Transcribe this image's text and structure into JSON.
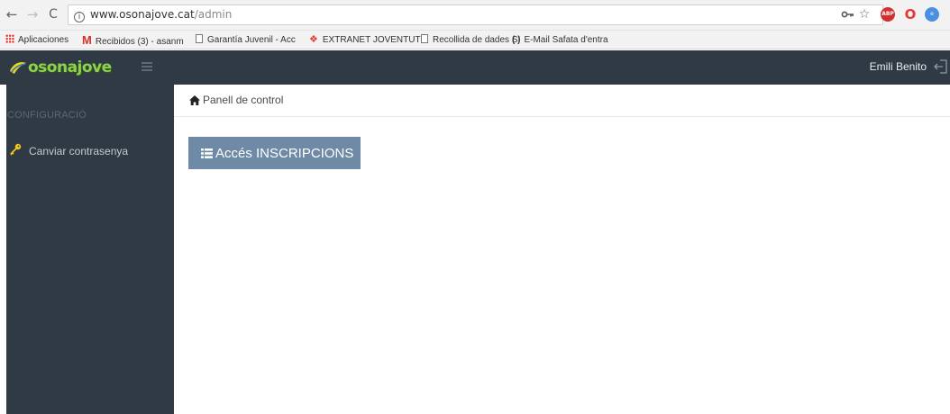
{
  "browser": {
    "url_host": "www.osonajove.cat",
    "url_path": "/admin",
    "bookmarks": [
      {
        "label": "Aplicaciones",
        "icon": "apps-grid-icon"
      },
      {
        "label": "Recibidos (3) - asanm",
        "icon": "gmail-icon"
      },
      {
        "label": "Garantía Juvenil - Acc",
        "icon": "page-icon"
      },
      {
        "label": "EXTRANET JOVENTUT",
        "icon": "extension-icon"
      },
      {
        "label": "Recollida de dades SI",
        "icon": "page-icon"
      },
      {
        "label": "E-Mail Safata d'entra",
        "icon": "parentheses-icon"
      }
    ],
    "gmail_glyph": "M",
    "paren_glyph": "( )"
  },
  "app": {
    "logo_text": "osonajove",
    "user_name": "Emili Benito",
    "colors": {
      "topbar": "#2f3a44",
      "logo_green": "#8fd14f",
      "button": "#6f8aa6",
      "key_yellow": "#f5c518"
    }
  },
  "sidebar": {
    "section_title": "CONFIGURACIÓ",
    "items": [
      {
        "label": "Canviar contrasenya",
        "icon": "key-icon"
      }
    ]
  },
  "breadcrumb": {
    "label": "Panell de control",
    "icon": "home-icon"
  },
  "main": {
    "button_label": "Accés INSCRIPCIONS",
    "button_icon": "list-icon"
  }
}
